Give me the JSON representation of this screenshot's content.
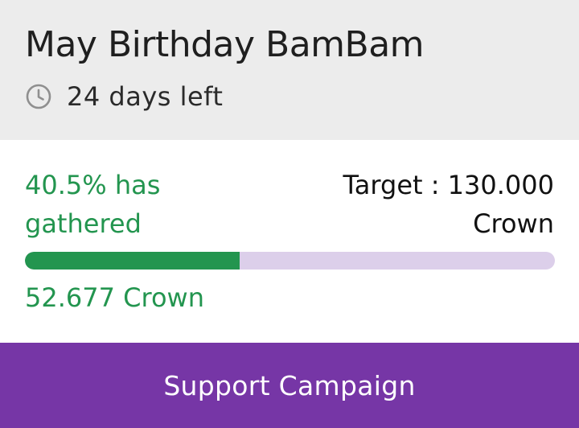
{
  "campaign": {
    "title": "May Birthday BamBam",
    "time_left": "24 days left",
    "clock_icon": "clock-icon"
  },
  "progress": {
    "gathered_label": "40.5% has gathered",
    "percent": 40.5,
    "target_label": "Target : 130.000 Crown",
    "collected_label": "52.677 Crown"
  },
  "actions": {
    "support_label": "Support Campaign"
  },
  "colors": {
    "header_bg": "#ececec",
    "accent_green": "#23954f",
    "track": "#dccfea",
    "button_purple": "#7636a6"
  }
}
